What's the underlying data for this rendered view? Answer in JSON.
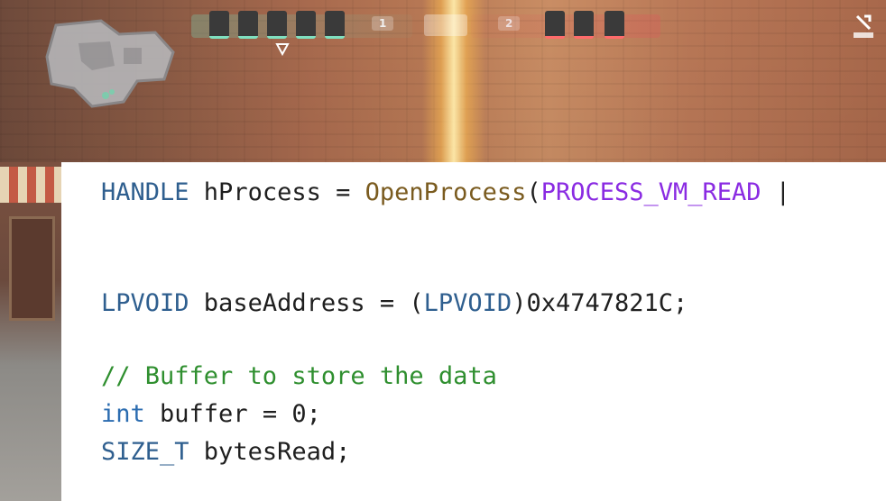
{
  "hud": {
    "team_score": "1",
    "enemy_score": "2"
  },
  "code": {
    "line1": {
      "type": "HANDLE",
      "var": " hProcess = ",
      "fn": "OpenProcess",
      "paren": "(",
      "macro": "PROCESS_VM_READ",
      "rest": " |"
    },
    "line2": {
      "type": "LPVOID",
      "var": " baseAddress = (",
      "cast": "LPVOID",
      "rest": ")0x4747821C;"
    },
    "line3": {
      "comment": "// Buffer to store the data"
    },
    "line4": {
      "kw": "int",
      "rest": " buffer = 0;"
    },
    "line5": {
      "type": "SIZE_T",
      "rest": " bytesRead;"
    }
  },
  "colors": {
    "keyword": "#2b6cb0",
    "macro": "#8a2be2",
    "comment": "#2f8f2f",
    "function": "#7a5b1f",
    "team": "#7fe0c0",
    "enemy": "#ff6b6b"
  }
}
